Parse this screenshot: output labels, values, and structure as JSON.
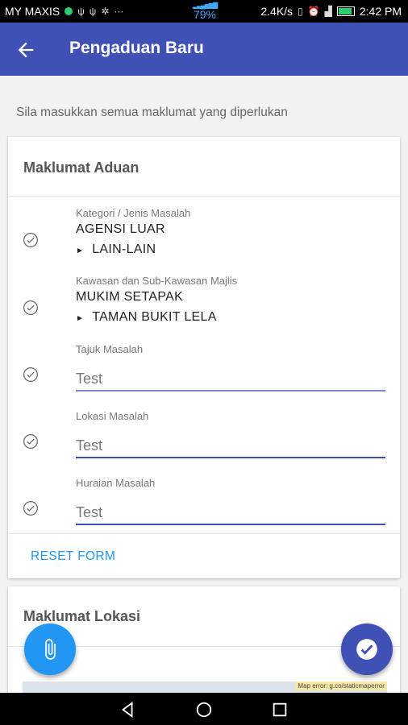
{
  "status_bar": {
    "carrier": "MY MAXIS",
    "signal_percent": "79%",
    "net_speed": "2.4K/s",
    "time": "2:42 PM",
    "dots": "···"
  },
  "app_bar": {
    "title": "Pengaduan Baru"
  },
  "intro_text": "Sila masukkan semua maklumat yang diperlukan",
  "card_aduan": {
    "title": "Maklumat Aduan",
    "fields": [
      {
        "label": "Kategori / Jenis Masalah",
        "value": "AGENSI LUAR",
        "sub_value": "LAIN-LAIN"
      },
      {
        "label": "Kawasan dan Sub-Kawasan Majlis",
        "value": "MUKIM SETAPAK",
        "sub_value": "TAMAN BUKIT LELA"
      },
      {
        "label": "Tajuk Masalah",
        "value": "Test"
      },
      {
        "label": "Lokasi Masalah",
        "value": "Test"
      },
      {
        "label": "Huraian Masalah",
        "value": "Test"
      }
    ],
    "reset_label": "RESET FORM"
  },
  "card_lokasi": {
    "title": "Maklumat Lokasi",
    "map_error": "Map error: g.co/staticmaperror"
  },
  "colors": {
    "primary": "#3f51b5",
    "accent": "#2196f3",
    "status_green": "#2ecc71"
  },
  "icons": {
    "back": "arrow-left-icon",
    "check": "check-circle-icon",
    "attach": "paperclip-icon",
    "submit": "check-icon"
  }
}
